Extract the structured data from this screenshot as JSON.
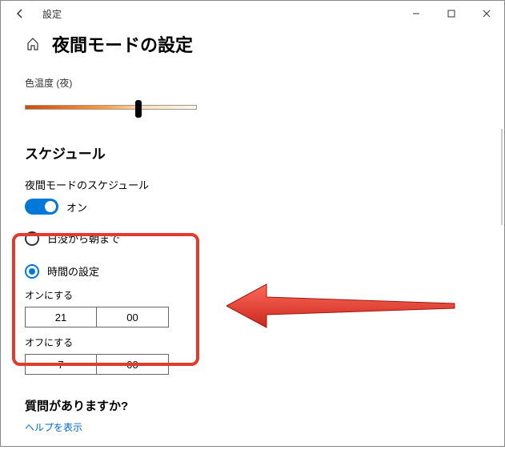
{
  "window": {
    "title": "設定"
  },
  "page": {
    "heading": "夜間モードの設定",
    "color_temp_label": "色温度 (夜)",
    "schedule_heading": "スケジュール",
    "schedule_sub": "夜間モードのスケジュール",
    "toggle_state": "オン",
    "radio_sunset": "日没から朝まで",
    "radio_hours": "時間の設定",
    "turn_on_label": "オンにする",
    "turn_on_hour": "21",
    "turn_on_min": "00",
    "turn_off_label": "オフにする",
    "turn_off_hour": "7",
    "turn_off_min": "00",
    "question_heading": "質問がありますか?",
    "help_link": "ヘルプを表示"
  }
}
